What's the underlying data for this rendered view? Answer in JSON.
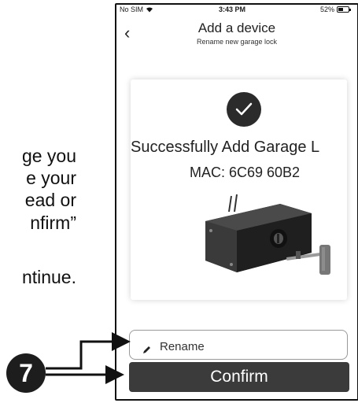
{
  "manual": {
    "lines": [
      "ge you",
      "e your",
      "ead or",
      "nfirm”",
      "ntinue."
    ],
    "step_number": "7"
  },
  "status_bar": {
    "carrier": "No SIM",
    "time": "3:43 PM",
    "battery": "52%",
    "wifi_icon": "wifi-icon",
    "battery_icon": "battery-icon"
  },
  "nav": {
    "back_icon": "chevron-left-icon",
    "title": "Add a device",
    "subtitle": "Rename new garage lock"
  },
  "card": {
    "check_icon": "checkmark-icon",
    "success_text": "Successfully Add Garage L",
    "mac_text": "MAC: 6C69 60B2",
    "image": "garage-lock-device-image"
  },
  "rename": {
    "icon": "pencil-icon",
    "placeholder": "Rename"
  },
  "confirm_label": "Confirm",
  "colors": {
    "button": "#3b3b3b",
    "badge": "#1d1d1d",
    "check_circle": "#2b2b2b"
  }
}
